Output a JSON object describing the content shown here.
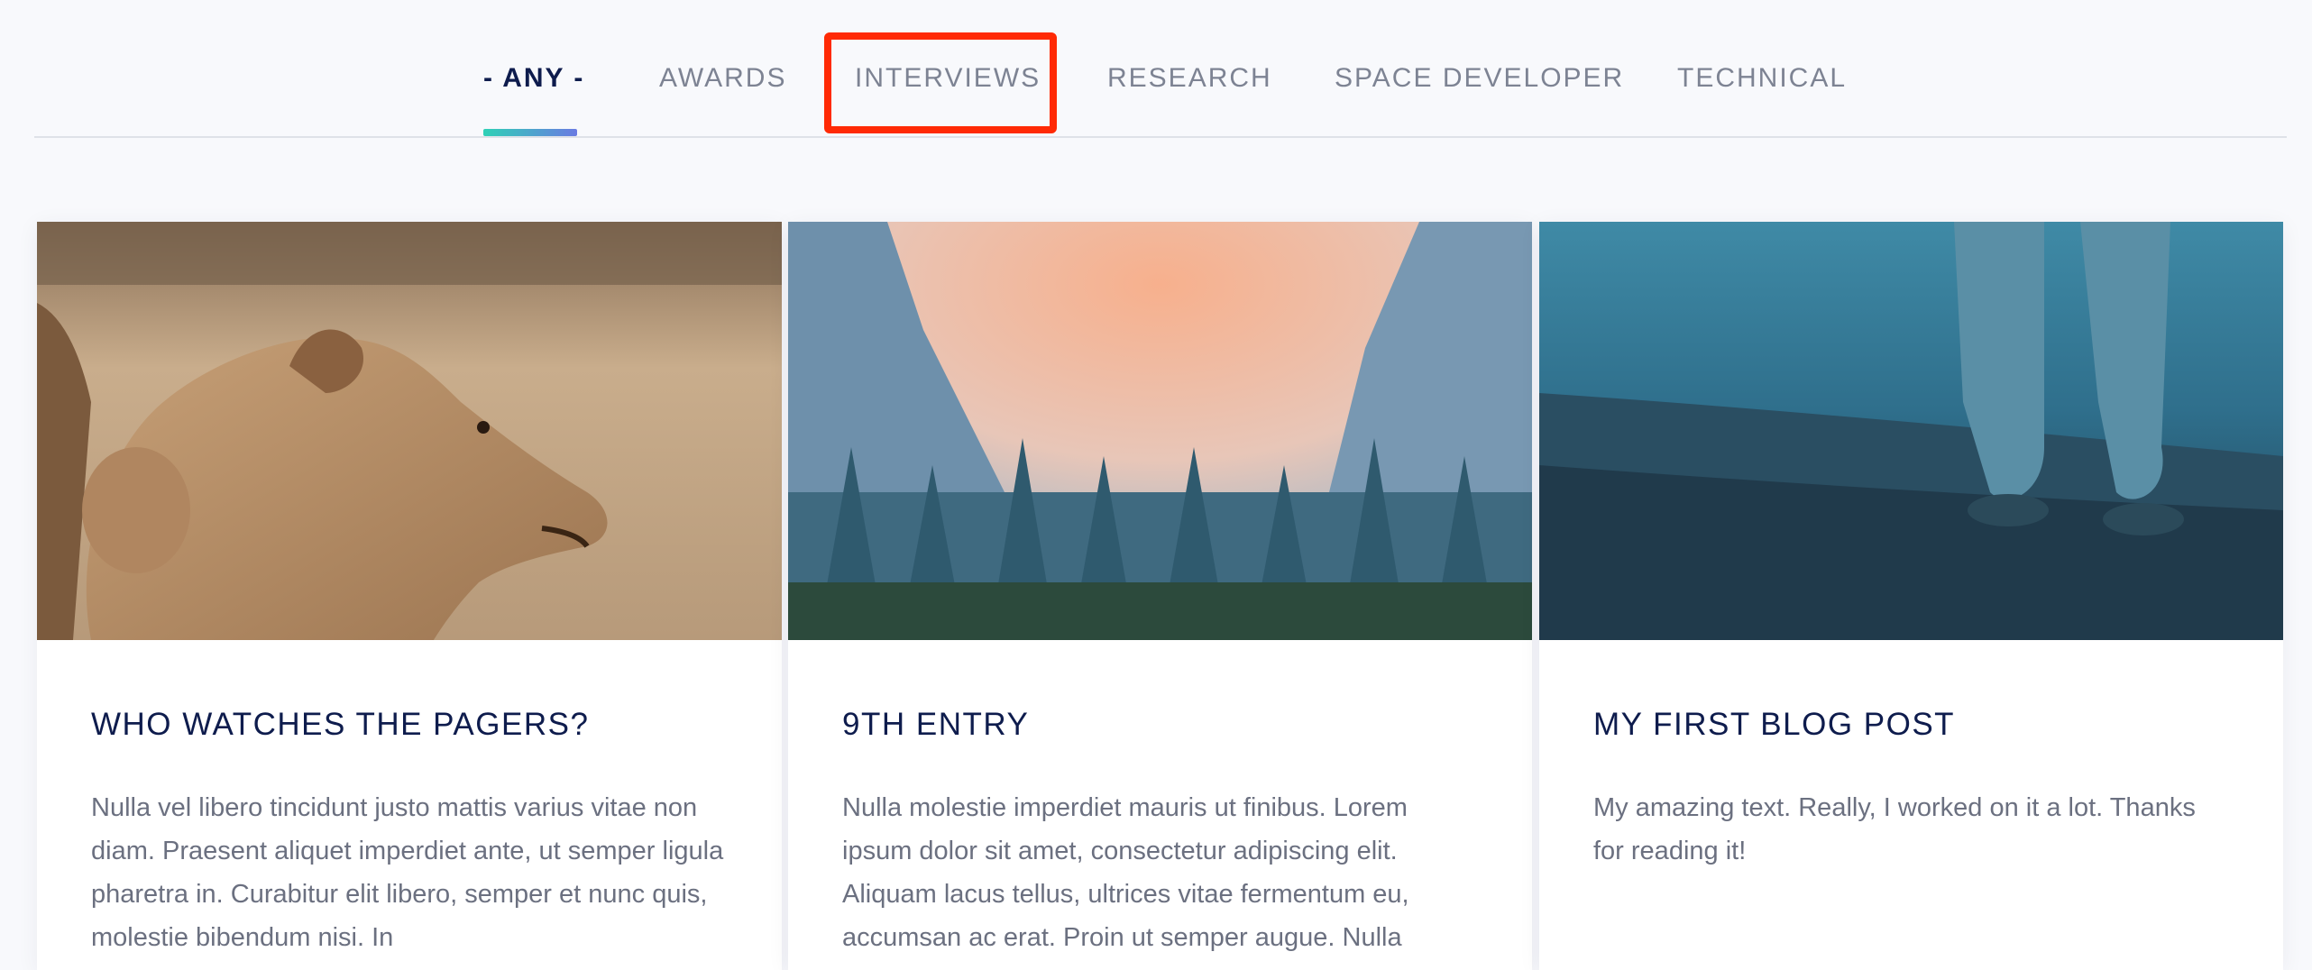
{
  "tabs": [
    {
      "label": "- ANY -",
      "active": true
    },
    {
      "label": "AWARDS"
    },
    {
      "label": "INTERVIEWS"
    },
    {
      "label": "RESEARCH"
    },
    {
      "label": "SPACE DEVELOPER"
    },
    {
      "label": "TECHNICAL"
    }
  ],
  "accent_colors": {
    "tab_underline_start": "#2fd1b6",
    "tab_underline_end": "#6a7be2",
    "highlight_box": "#ff2a05",
    "title_text": "#0e1c4d"
  },
  "posts": [
    {
      "image": "lioness-photo",
      "title": "WHO WATCHES THE PAGERS?",
      "excerpt": "Nulla vel libero tincidunt justo mattis varius vitae non diam. Praesent aliquet imperdiet ante, ut semper ligula pharetra in. Curabitur elit libero, semper et nunc quis, molestie bibendum nisi. In"
    },
    {
      "image": "forest-valley-photo",
      "title": "9TH ENTRY",
      "excerpt": "Nulla molestie imperdiet mauris ut finibus. Lorem ipsum dolor sit amet, consectetur adipiscing elit. Aliquam lacus tellus, ultrices vitae fermentum eu, accumsan ac erat. Proin ut semper augue. Nulla"
    },
    {
      "image": "astronaut-legs-photo",
      "title": "MY FIRST BLOG POST",
      "excerpt": "My amazing text. Really, I worked on it a lot. Thanks for reading it!"
    }
  ]
}
